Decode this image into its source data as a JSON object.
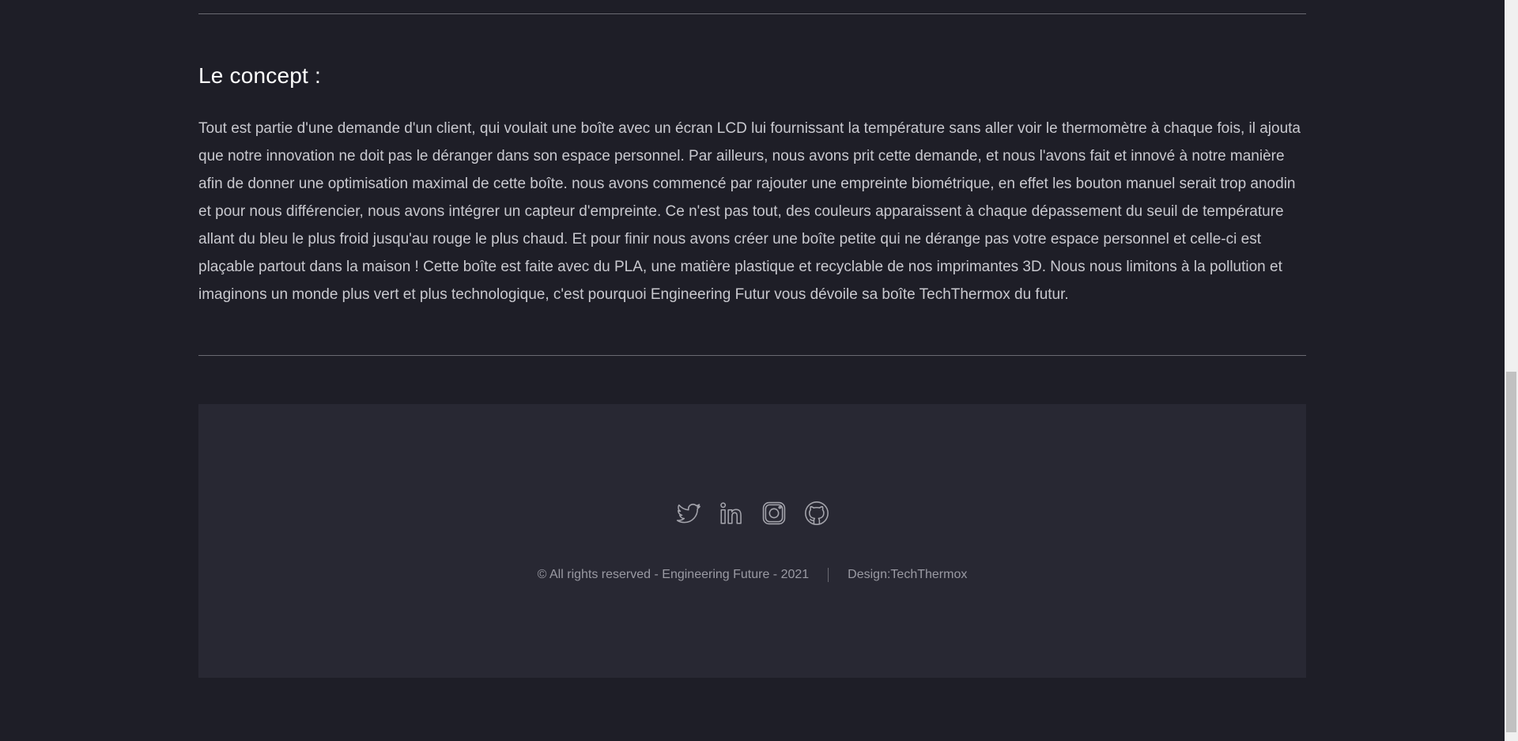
{
  "concept": {
    "title": "Le concept :",
    "body": "Tout est partie d'une demande d'un client, qui voulait une boîte avec un écran LCD lui fournissant la température sans aller voir le thermomètre à chaque fois, il ajouta que notre innovation ne doit pas le déranger dans son espace personnel. Par ailleurs, nous avons prit cette demande, et nous l'avons fait et innové à notre manière afin de donner une optimisation maximal de cette boîte. nous avons commencé par rajouter une empreinte biométrique, en effet les bouton manuel serait trop anodin et pour nous différencier, nous avons intégrer un capteur d'empreinte. Ce n'est pas tout, des couleurs apparaissent à chaque dépassement du seuil de température allant du bleu le plus froid jusqu'au rouge le plus chaud. Et pour finir nous avons créer une boîte petite qui ne dérange pas votre espace personnel et celle-ci est plaçable partout dans la maison ! Cette boîte est faite avec du PLA, une matière plastique et recyclable de nos imprimantes 3D. Nous nous limitons à la pollution et imaginons un monde plus vert et plus technologique, c'est pourquoi Engineering Futur vous dévoile sa boîte TechThermox du futur."
  },
  "footer": {
    "socials": [
      {
        "icon": "twitter-icon"
      },
      {
        "icon": "linkedin-icon"
      },
      {
        "icon": "instagram-icon"
      },
      {
        "icon": "github-icon"
      }
    ],
    "copyright": "© All rights reserved - Engineering Future - 2021",
    "design": "Design:TechThermox"
  },
  "colors": {
    "background": "#1e1e27",
    "footer_background": "#282833",
    "icon_stroke": "#a4a4ac"
  }
}
